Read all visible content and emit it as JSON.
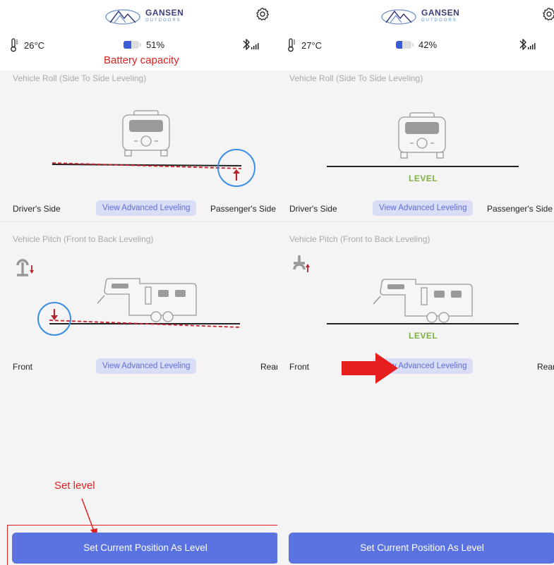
{
  "left": {
    "brand": {
      "name": "GANSEN",
      "sub": "OUTDOORS"
    },
    "status": {
      "temperature": "26°C",
      "battery": "51%",
      "battery_level": 0.51
    },
    "roll": {
      "title": "Vehicle Roll (Side To Side Leveling)",
      "left_label": "Driver's Side",
      "right_label": "Passenger's Side",
      "advanced_label": "View Advanced Leveling"
    },
    "pitch": {
      "title": "Vehicle Pitch (Front to Back Leveling)",
      "left_label": "Front",
      "right_label": "Rear",
      "advanced_label": "View Advanced Leveling"
    },
    "set_level_label": "Set Current Position As Level"
  },
  "right": {
    "brand": {
      "name": "GANSEN",
      "sub": "OUTDOORS"
    },
    "status": {
      "temperature": "27°C",
      "battery": "42%",
      "battery_level": 0.42
    },
    "roll": {
      "title": "Vehicle Roll (Side To Side Leveling)",
      "status": "LEVEL",
      "left_label": "Driver's Side",
      "right_label": "Passenger's Side",
      "advanced_label": "View Advanced Leveling"
    },
    "pitch": {
      "title": "Vehicle Pitch (Front to Back Leveling)",
      "status": "LEVEL",
      "left_label": "Front",
      "right_label": "Rear",
      "advanced_label": "View Advanced Leveling"
    },
    "set_level_label": "Set Current Position As Level"
  },
  "annotations": {
    "battery_capacity": "Battery capacity",
    "set_level": "Set level"
  },
  "colors": {
    "accent": "#5a73e0",
    "level_green": "#7cb342",
    "annotation_red": "#e02020",
    "indicator_dark_red": "#b3262e",
    "highlight_circle": "#3a8ee6"
  },
  "icons": [
    "mountain-logo-icon",
    "gear-icon",
    "thermometer-icon",
    "battery-icon",
    "bluetooth-signal-icon",
    "camper-rear-icon",
    "fifth-wheel-trailer-icon",
    "hitch-icon",
    "arrow-up-icon",
    "arrow-down-icon"
  ]
}
